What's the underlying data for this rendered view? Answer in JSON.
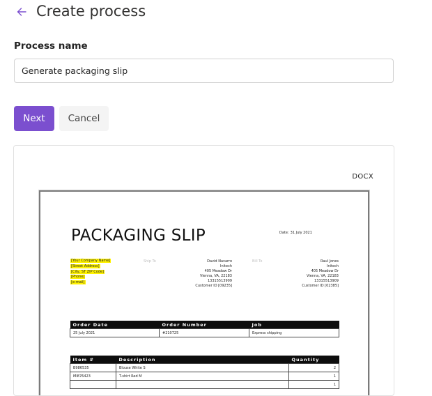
{
  "header": {
    "title": "Create process",
    "back_icon": "arrow-left-icon"
  },
  "form": {
    "label": "Process name",
    "value": "Generate packaging slip"
  },
  "buttons": {
    "next": "Next",
    "cancel": "Cancel"
  },
  "colors": {
    "accent": "#7b4fcf",
    "highlight": "#fff200"
  },
  "preview": {
    "file_type": "DOCX",
    "doc": {
      "title": "PACKAGING SLIP",
      "date_label": "Date:",
      "date_value": "31 July 2021",
      "company": [
        "[Your Company Name]",
        "[Street Address]",
        "[City, ST ZIP Code]",
        "[Phone]",
        "[e-mail]"
      ],
      "ship_to_label": "Ship To",
      "ship_to": [
        "David Navarro",
        "Initech",
        "405 Meadow Dr",
        "Vienna, VA, 22183",
        "13315513909",
        "Customer ID [09235]"
      ],
      "bill_to_label": "Bill To",
      "bill_to": [
        "Raul Jones",
        "Initech",
        "405 Meadow Dr",
        "Vienna, VA, 22183",
        "13315513909",
        "Customer ID [02385]"
      ],
      "order_table": {
        "headers": [
          "Order Date",
          "Order Number",
          "Job"
        ],
        "row": [
          "25 July 2021",
          "#210725",
          "Express shipping"
        ]
      },
      "items_table": {
        "headers": [
          "Item #",
          "Description",
          "Quantity"
        ],
        "rows": [
          [
            "B986535",
            "Blouse White S",
            "2"
          ],
          [
            "MI876423",
            "T-shirt Red M",
            "1"
          ],
          [
            "",
            "",
            "1"
          ]
        ]
      }
    }
  }
}
